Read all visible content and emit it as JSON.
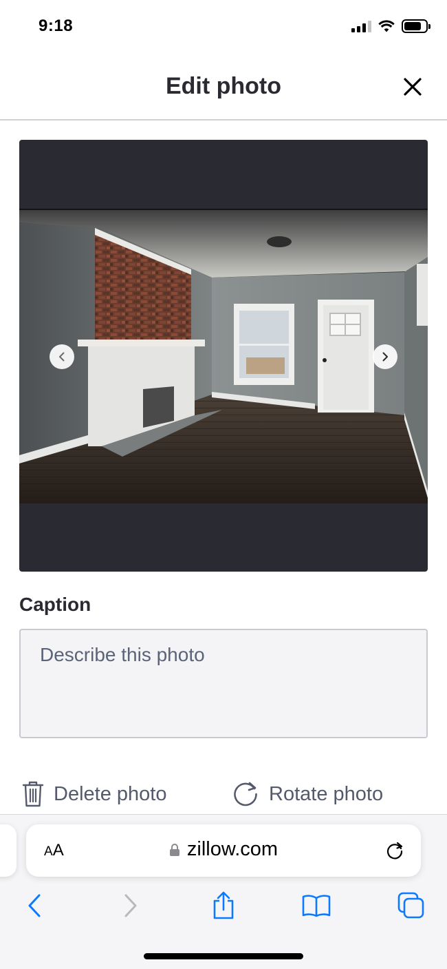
{
  "status_bar": {
    "time": "9:18"
  },
  "header": {
    "title": "Edit photo"
  },
  "photo_viewer": {
    "prev_icon": "chevron-left-icon",
    "next_icon": "chevron-right-icon"
  },
  "caption": {
    "label": "Caption",
    "placeholder": "Describe this photo",
    "value": ""
  },
  "actions": {
    "delete_label": "Delete photo",
    "rotate_label": "Rotate photo"
  },
  "browser": {
    "text_size_label_big": "A",
    "text_size_label_small": "A",
    "url": "zillow.com"
  },
  "colors": {
    "text": "#2a2a33",
    "photo_bg": "#2a2a33",
    "ios_blue": "#0a7aff",
    "muted": "#54596b"
  }
}
